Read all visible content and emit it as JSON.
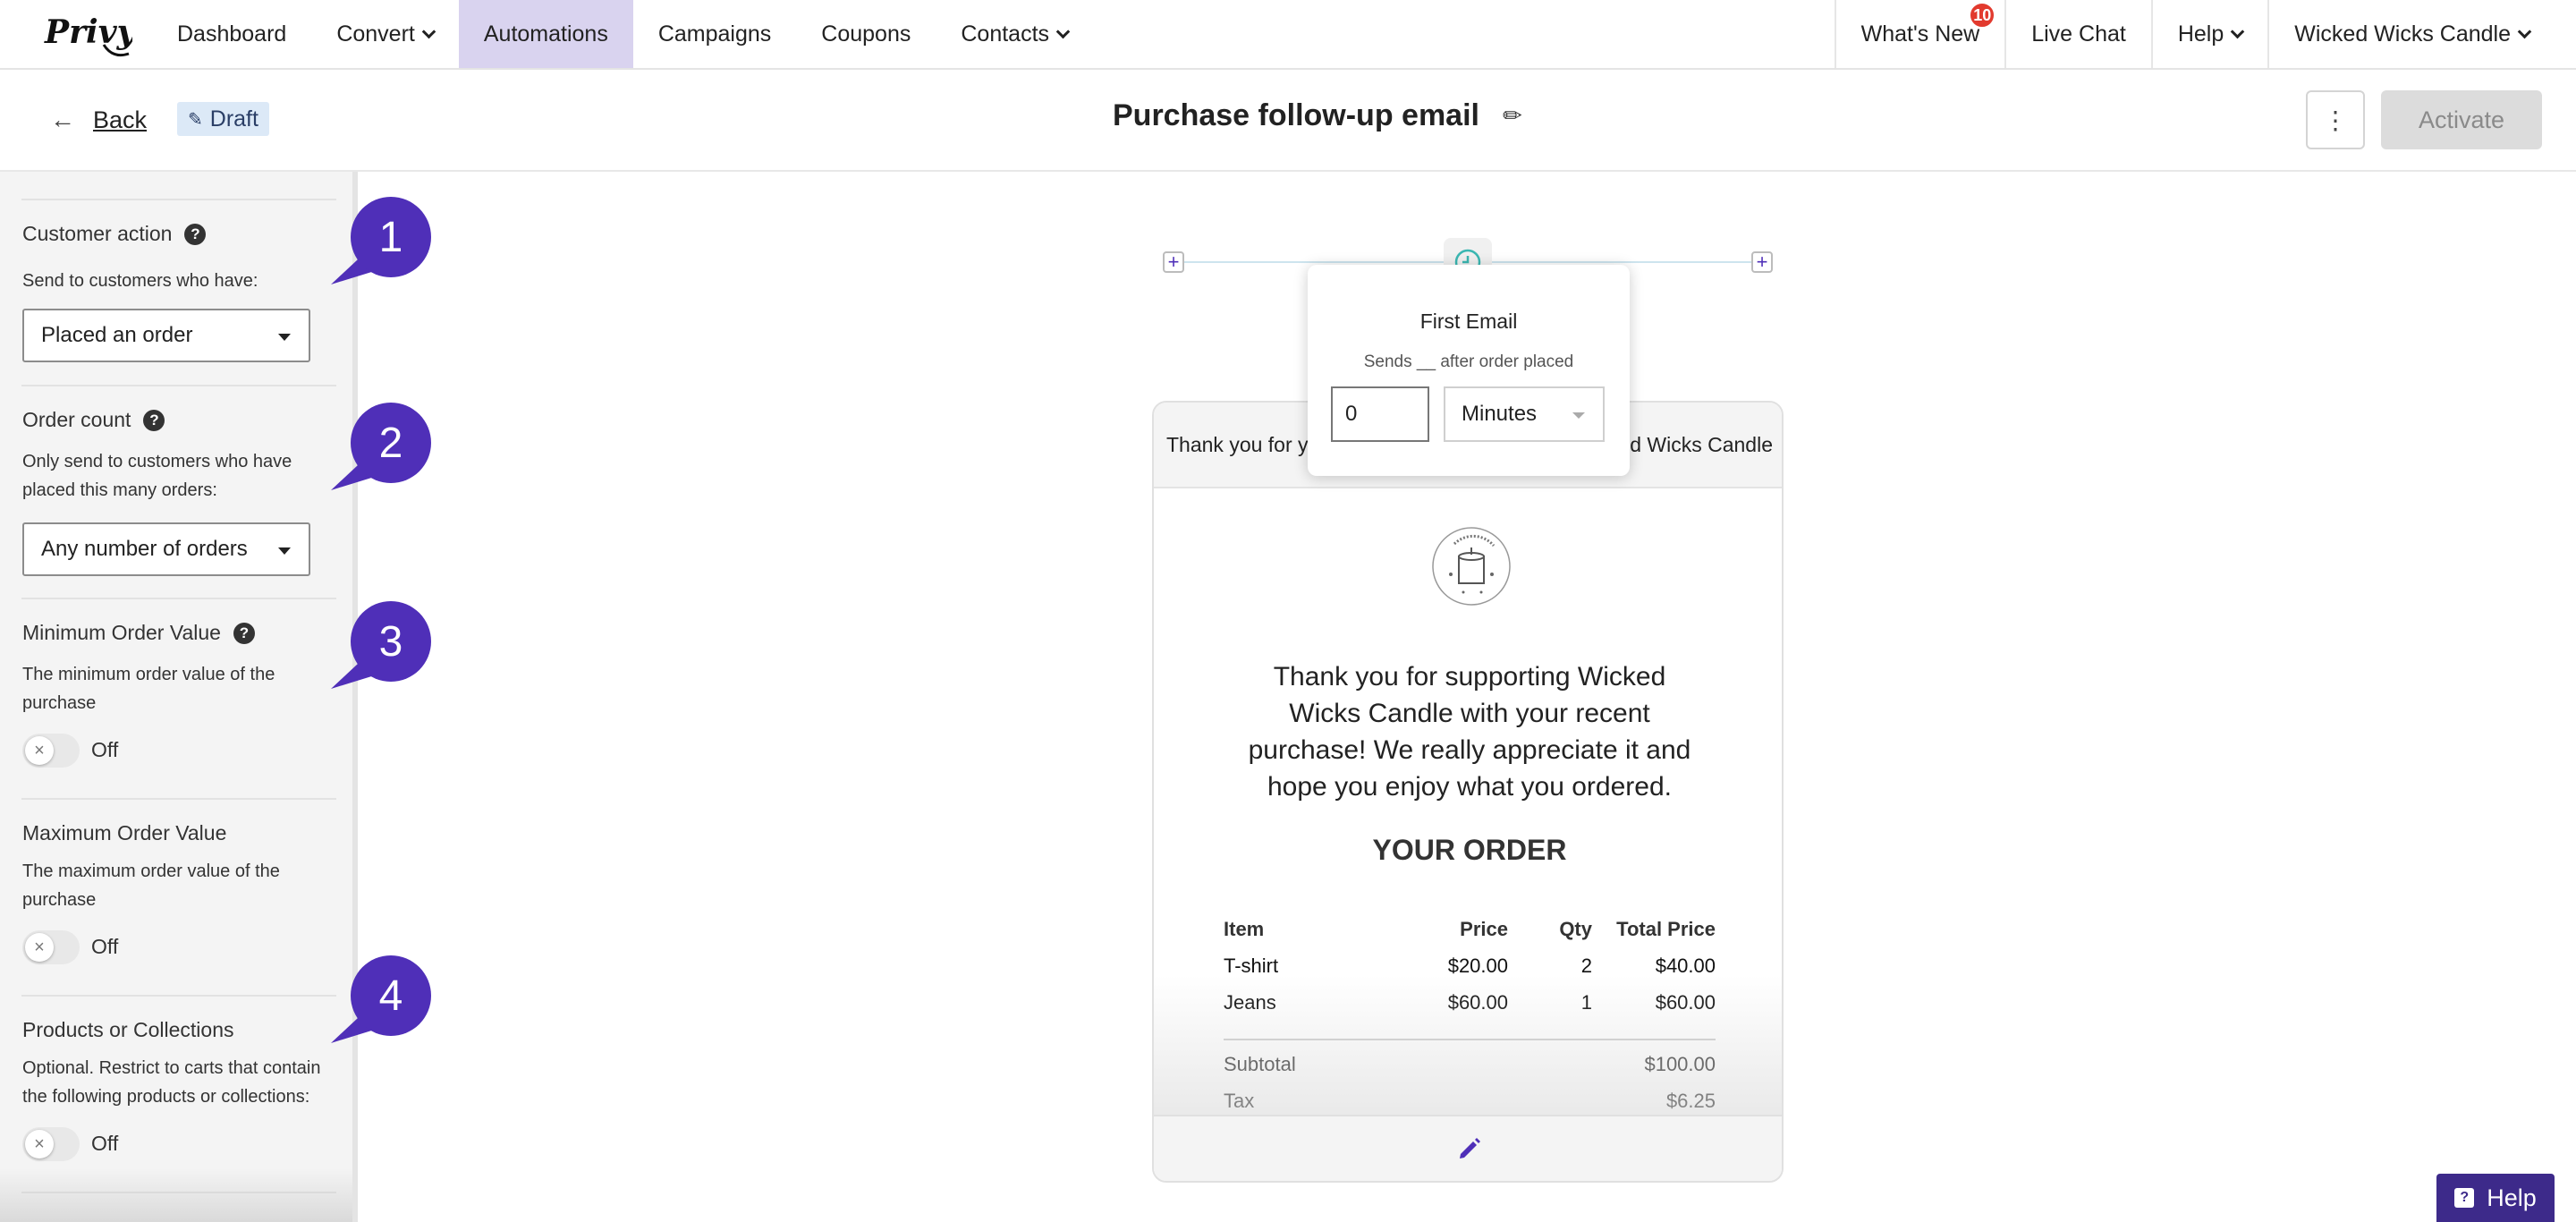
{
  "nav": {
    "logo_alt": "Privy",
    "items": [
      {
        "label": "Dashboard",
        "dropdown": false,
        "active": false
      },
      {
        "label": "Convert",
        "dropdown": true,
        "active": false
      },
      {
        "label": "Automations",
        "dropdown": false,
        "active": true
      },
      {
        "label": "Campaigns",
        "dropdown": false,
        "active": false
      },
      {
        "label": "Coupons",
        "dropdown": false,
        "active": false
      },
      {
        "label": "Contacts",
        "dropdown": true,
        "active": false
      }
    ],
    "whats_new": "What's New",
    "whats_new_badge": "10",
    "live_chat": "Live Chat",
    "help": "Help",
    "account": "Wicked Wicks Candle"
  },
  "header": {
    "back_label": "Back",
    "status_label": "Draft",
    "title": "Purchase follow-up email",
    "more_icon": "vertical-dots-icon",
    "activate_label": "Activate"
  },
  "sidebar": {
    "customer_action": {
      "heading": "Customer action",
      "desc": "Send to customers who have:",
      "value": "Placed an order"
    },
    "order_count": {
      "heading": "Order count",
      "desc": "Only send to customers who have placed this many orders:",
      "value": "Any number of orders"
    },
    "min_order": {
      "heading": "Minimum Order Value",
      "desc": "The minimum order value of the purchase",
      "toggle": "Off"
    },
    "max_order": {
      "heading": "Maximum Order Value",
      "desc": "The maximum order value of the purchase",
      "toggle": "Off"
    },
    "products": {
      "heading": "Products or Collections",
      "desc": "Optional. Restrict to carts that contain the following products or collections:",
      "toggle": "Off"
    }
  },
  "callouts": [
    "1",
    "2",
    "3",
    "4"
  ],
  "callout_color": "#4f2fb8",
  "popover": {
    "title": "First Email",
    "subtitle": "Sends __ after order placed",
    "delay_value": "0",
    "unit": "Minutes"
  },
  "email": {
    "subject_left": "Thank you for y",
    "subject_right": "d Wicks Candle",
    "message": "Thank you for supporting Wicked Wicks Candle with your recent purchase! We really appreciate it and hope you enjoy what you ordered.",
    "order_heading": "YOUR ORDER",
    "columns": {
      "item": "Item",
      "price": "Price",
      "qty": "Qty",
      "total": "Total Price"
    },
    "rows": [
      {
        "item": "T-shirt",
        "price": "$20.00",
        "qty": "2",
        "total": "$40.00"
      },
      {
        "item": "Jeans",
        "price": "$60.00",
        "qty": "1",
        "total": "$60.00"
      }
    ],
    "subtotal_label": "Subtotal",
    "subtotal_value": "$100.00",
    "tax_label": "Tax",
    "tax_value": "$6.25"
  },
  "help_button": "Help",
  "colors": {
    "accent": "#4f2fb8",
    "nav_active_bg": "#d9d3ef",
    "draft_bg": "#dce9f7",
    "badge": "#e23a2e",
    "help_bg": "#3d2a8a"
  }
}
